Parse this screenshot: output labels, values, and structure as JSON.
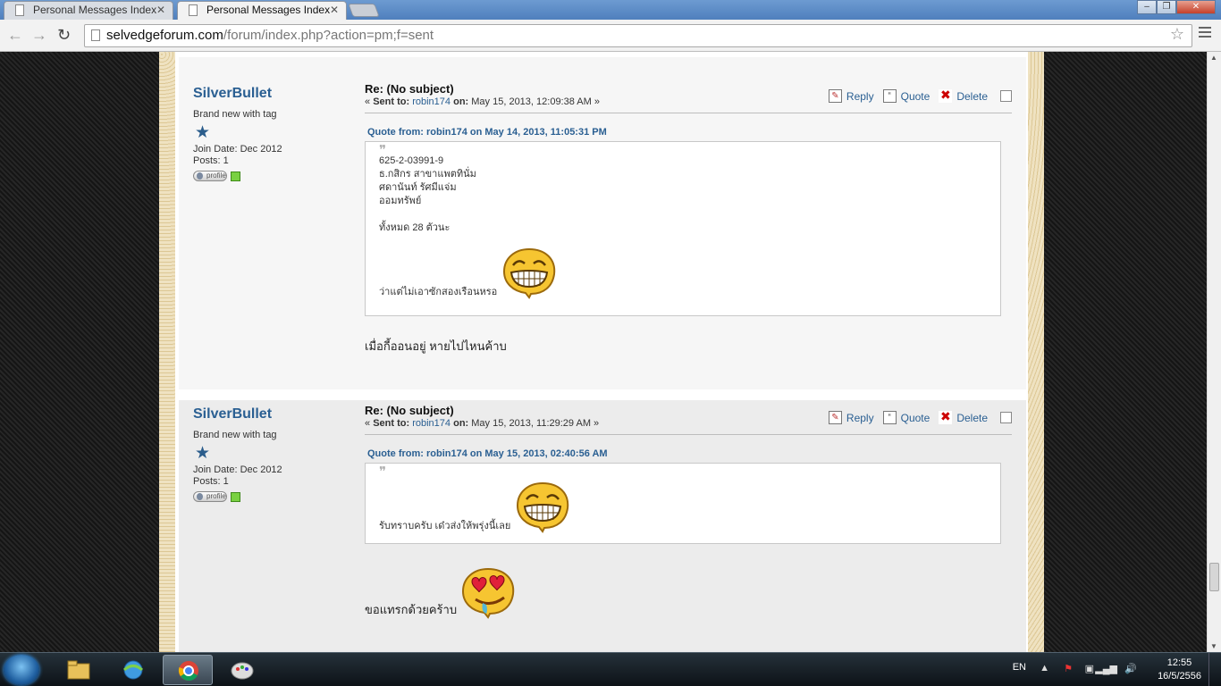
{
  "browser": {
    "tabs": [
      {
        "title": "Personal Messages Index",
        "active": false
      },
      {
        "title": "Personal Messages Index",
        "active": true
      }
    ],
    "url_host": "selvedgeforum.com",
    "url_path": "/forum/index.php?action=pm;f=sent"
  },
  "posts": [
    {
      "author": "SilverBullet",
      "group": "Brand new with tag",
      "join_date": "Join Date: Dec 2012",
      "posts_count": "Posts: 1",
      "profile_label": "profile",
      "subject": "Re: (No subject)",
      "sent_prefix": "« ",
      "sent_label": "Sent to:",
      "recipient": "robin174",
      "on_label": "on:",
      "date": "May 15, 2013, 12:09:38 AM »",
      "actions": {
        "reply": "Reply",
        "quote": "Quote",
        "delete": "Delete"
      },
      "quote_header": "Quote from: robin174 on May 14, 2013, 11:05:31 PM",
      "quote_lines": [
        "625-2-03991-9",
        "ธ.กสิกร สาขาแพตทินั่ม",
        "ศดานันท์ รัศมีแจ่ม",
        "ออมทรัพย์",
        "",
        "ทั้งหมด 28 ตัวนะ"
      ],
      "quote_last": "ว่าแต่ไม่เอาซักสองเรือนหรอ",
      "reply": "เมื่อกี้ออนอยู่ หายไปไหนค้าบ"
    },
    {
      "author": "SilverBullet",
      "group": "Brand new with tag",
      "join_date": "Join Date: Dec 2012",
      "posts_count": "Posts: 1",
      "profile_label": "profile",
      "subject": "Re: (No subject)",
      "sent_prefix": "« ",
      "sent_label": "Sent to:",
      "recipient": "robin174",
      "on_label": "on:",
      "date": "May 15, 2013, 11:29:29 AM »",
      "actions": {
        "reply": "Reply",
        "quote": "Quote",
        "delete": "Delete"
      },
      "quote_header": "Quote from: robin174 on May 15, 2013, 02:40:56 AM",
      "quote_last": "รับทราบครับ เด๋วส่งให้พรุ่งนี้เลย",
      "reply": "ขอแทรกด้วยคร้าบ"
    }
  ],
  "taskbar": {
    "language": "EN",
    "time": "12:55",
    "date": "16/5/2556"
  },
  "colors": {
    "link": "#2a5f92",
    "accent_star": "#2b5d8c",
    "online": "#79d141"
  },
  "icons": [
    "reply-icon",
    "quote-icon",
    "delete-icon",
    "rank-star-icon",
    "grin-emoji",
    "love-emoji"
  ]
}
